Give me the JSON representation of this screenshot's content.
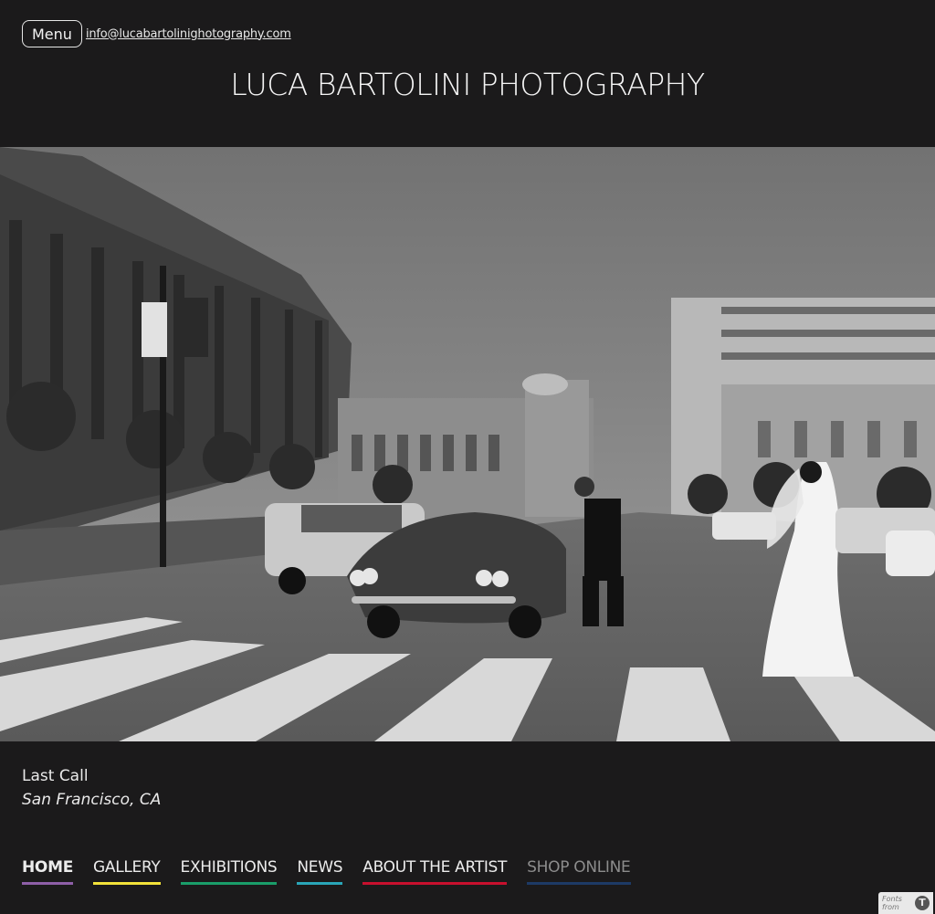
{
  "header": {
    "menu_label": "Menu",
    "email": "info@lucabartolinighotography.com",
    "site_title": "LUCA BARTOLINI PHOTOGRAPHY"
  },
  "photo": {
    "title": "Last Call",
    "location": "San Francisco, CA"
  },
  "nav": {
    "items": [
      {
        "label": "HOME",
        "underline": "#8e5fa8",
        "active": true
      },
      {
        "label": "GALLERY",
        "underline": "#f2e23a"
      },
      {
        "label": "EXHIBITIONS",
        "underline": "#1a9e6a"
      },
      {
        "label": "NEWS",
        "underline": "#2aa6b8"
      },
      {
        "label": "ABOUT THE ARTIST",
        "underline": "#c8102e"
      },
      {
        "label": "SHOP ONLINE",
        "underline": "#1d3a66",
        "muted": true
      }
    ]
  },
  "badge": {
    "line1": "Fonts",
    "line2": "from",
    "logo": "T"
  }
}
